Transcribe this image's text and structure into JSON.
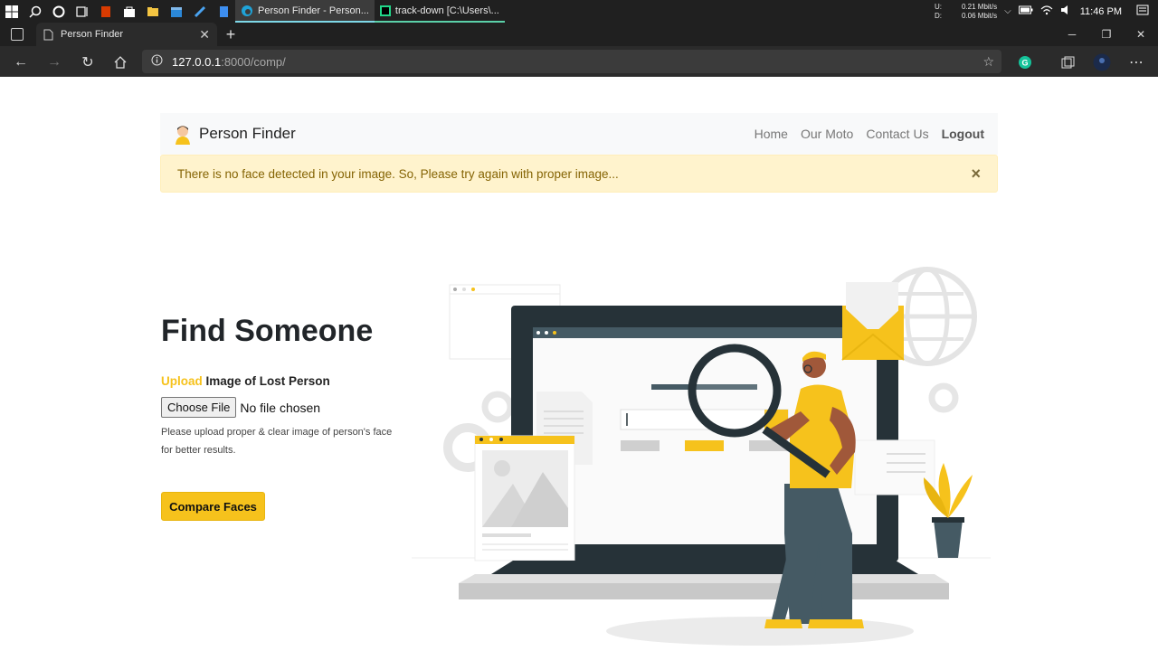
{
  "taskbar": {
    "apps": [
      {
        "label": "Person Finder - Person..."
      },
      {
        "label": "track-down [C:\\Users\\..."
      }
    ],
    "network": {
      "up_label": "U:",
      "up_value": "0.21 Mbit/s",
      "down_label": "D:",
      "down_value": "0.06 Mbit/s"
    },
    "clock": "11:46 PM"
  },
  "browser": {
    "tab_title": "Person Finder",
    "url_host": "127.0.0.1",
    "url_path": ":8000/comp/"
  },
  "site": {
    "brand": "Person Finder",
    "nav": [
      "Home",
      "Our Moto",
      "Contact Us",
      "Logout"
    ],
    "alert": "There is no face detected in your image. So, Please try again with proper image...",
    "alert_close": "×"
  },
  "hero": {
    "title": "Find Someone",
    "upload_accent": "Upload",
    "upload_rest": " Image of Lost Person",
    "file_button": "Choose File",
    "file_status": "No file chosen",
    "hint": "Please upload proper & clear image of person's face for better results.",
    "submit": "Compare Faces"
  },
  "colors": {
    "accent": "#f6c21c",
    "dark": "#263238",
    "alert_bg": "#fff3cd",
    "alert_text": "#856404"
  }
}
